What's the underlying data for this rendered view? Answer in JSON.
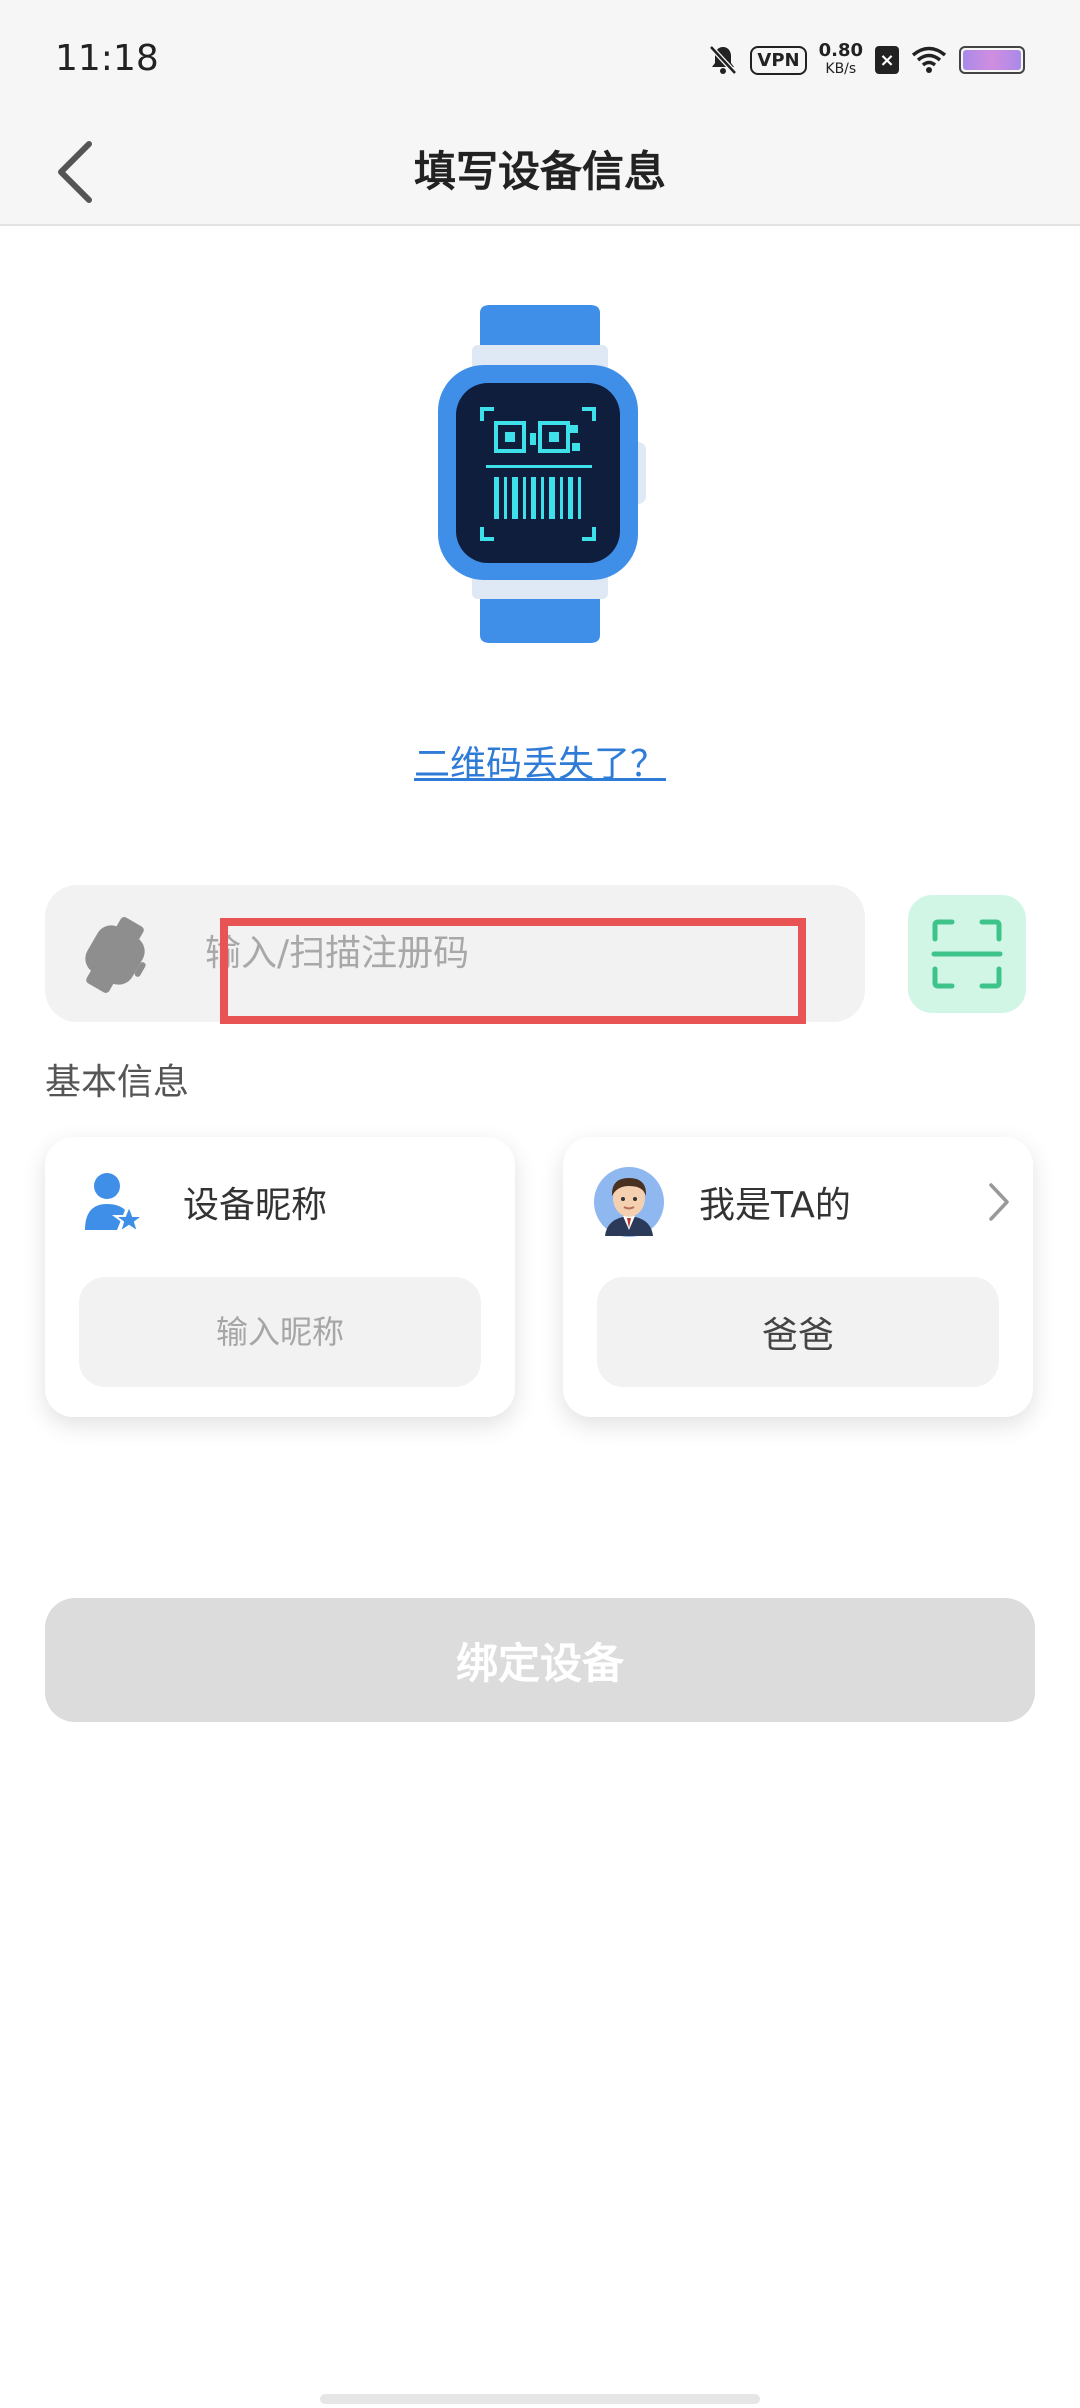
{
  "status_bar": {
    "time": "11:18",
    "vpn": "VPN",
    "net_speed_value": "0.80",
    "net_speed_unit": "KB/s",
    "icons": [
      "bell-off-icon",
      "vpn-icon",
      "x-box-icon",
      "wifi-icon",
      "battery-icon"
    ]
  },
  "nav": {
    "title": "填写设备信息",
    "back_icon": "chevron-left-icon"
  },
  "qr_lost_link": "二维码丢失了？",
  "register_code": {
    "placeholder": "输入/扫描注册码",
    "value": "",
    "scan_icon": "scan-icon"
  },
  "basic_info": {
    "section_title": "基本信息",
    "nickname_card": {
      "label": "设备昵称",
      "input_placeholder": "输入昵称",
      "input_value": ""
    },
    "relation_card": {
      "label": "我是TA的",
      "value": "爸爸"
    }
  },
  "bind_button_label": "绑定设备",
  "colors": {
    "link": "#2f7bd8",
    "scan_bg": "#d2f6e6",
    "scan_icon": "#3ec48b",
    "watch_blue": "#3f8fe8",
    "highlight": "#e85454",
    "disabled_button": "#dcdcdc"
  }
}
